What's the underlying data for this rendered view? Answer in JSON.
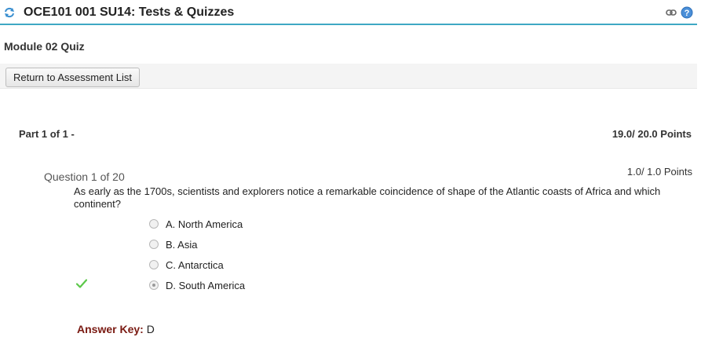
{
  "header": {
    "title": "OCE101 001 SU14: Tests & Quizzes"
  },
  "assessment": {
    "title": "Module 02 Quiz"
  },
  "toolbar": {
    "return_label": "Return to Assessment List"
  },
  "part": {
    "label": "Part 1 of 1 -",
    "points": "19.0/ 20.0 Points"
  },
  "question": {
    "number": "Question 1 of 20",
    "points": "1.0/ 1.0 Points",
    "text": "As early as the 1700s, scientists and explorers notice a remarkable coincidence of shape of the Atlantic coasts of Africa and which continent?",
    "options": [
      {
        "label": "A. North America",
        "selected": false
      },
      {
        "label": "B. Asia",
        "selected": false
      },
      {
        "label": "C. Antarctica",
        "selected": false
      },
      {
        "label": "D. South America",
        "selected": true
      }
    ],
    "answer_key_label": "Answer Key:",
    "answer_key_value": "D"
  },
  "colors": {
    "header_underline": "#3ea8c4",
    "correct_check": "#5cc84a",
    "answer_key_label": "#7a1a12"
  }
}
